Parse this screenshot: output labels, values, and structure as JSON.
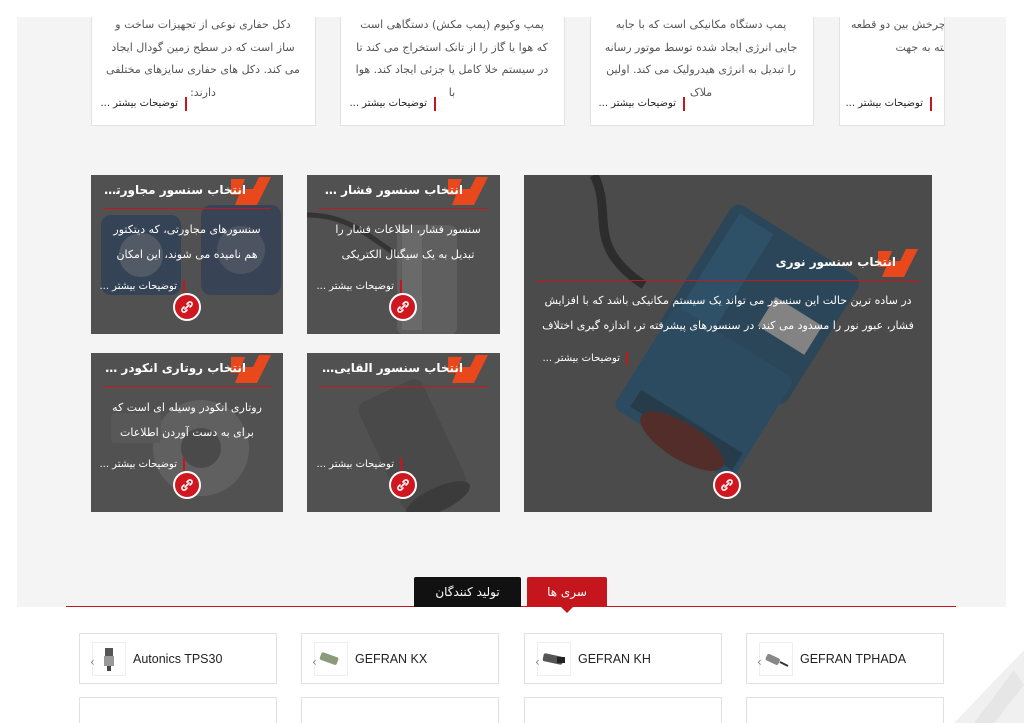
{
  "articles": [
    {
      "text": "بلبرینگ های المنت چرخش بین دو قطعه ...هند. بسته به جهت",
      "more": "توضیحات بیشتر ..."
    },
    {
      "text": "پمپ دستگاه مکانیکی است که با جابه جایی انرژی ایجاد شده توسط موتور رسانه را تبدیل به انرژی هیدرولیک می کند. اولین ملاک",
      "more": "توضیحات بیشتر ..."
    },
    {
      "text": "پمپ وکیوم (پمپ مکش) دستگاهی است که هوا یا گاز را از تانک استخراج می کند تا در سیستم خلا کامل یا جزئی ایجاد کند. هوا با",
      "more": "توضیحات بیشتر ..."
    },
    {
      "text": "دکل حفاری نوعی از تجهیزات ساخت و ساز است که در سطح زمین گودال ایجاد می کند. دکل های حفاری سایزهای مختلفی دارند:",
      "more": "توضیحات بیشتر ..."
    }
  ],
  "sensors": {
    "optical": {
      "title": "انتخاب سنسور نوری",
      "desc": "در ساده ترین حالت این سنسور می تواند یک سیستم مکانیکی باشد که با افزایش فشار، عبور نور را مسدود می کند. در سنسورهای پیشرفته تر، اندازه گیری اختلاف",
      "more": "توضیحات بیشتر ..."
    },
    "pressure": {
      "title": "انتخاب سنسور فشار مناسب",
      "desc": "سنسور فشار، اطلاعات فشار را تبدیل به یک سیگنال الکتریکی",
      "more": "توضیحات بیشتر ..."
    },
    "proximity": {
      "title": "انتخاب سنسور مجاورتی و القایی",
      "desc": "سنسورهای مجاورتی، که دیتکتور هم نامیده می شوند، این امکان",
      "more": "توضیحات بیشتر ..."
    },
    "inductive": {
      "title": "انتخاب سنسور القایی مناسب",
      "desc": "",
      "more": "توضیحات بیشتر ..."
    },
    "encoder": {
      "title": "انتخاب روتاری انکودر مناسب",
      "desc": "روتاری انکودر وسیله ای است که برای به دست آوردن اطلاعات",
      "more": "توضیحات بیشتر ..."
    }
  },
  "tabs": {
    "series": "سری ها",
    "manufacturers": "تولید کنندگان"
  },
  "products": [
    {
      "name": "GEFRAN TPHADA",
      "icon": "cable-sensor-icon"
    },
    {
      "name": "GEFRAN KH",
      "icon": "cylinder-sensor-icon"
    },
    {
      "name": "GEFRAN KX",
      "icon": "transducer-icon"
    },
    {
      "name": "Autonics TPS30",
      "icon": "pressure-switch-icon"
    }
  ],
  "colors": {
    "accent": "#c4161c",
    "brand_orange": "#e8481c",
    "tile_gray": "#6b6b6b",
    "tab_dark": "#111111"
  }
}
